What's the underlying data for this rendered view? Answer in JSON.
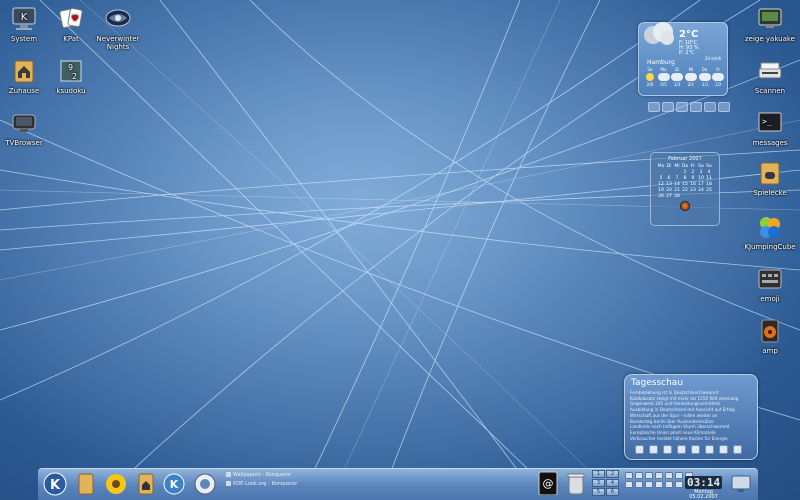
{
  "desktop_icons": [
    {
      "id": "system",
      "label": "System",
      "icon": "system-monitor-icon"
    },
    {
      "id": "kpat",
      "label": "KPat",
      "icon": "playing-cards-icon"
    },
    {
      "id": "nwn",
      "label": "Neverwinter\nNights",
      "icon": "neverwinter-nights-icon"
    },
    {
      "id": "zuhause",
      "label": "Zuhause",
      "icon": "home-folder-icon"
    },
    {
      "id": "ksudoku",
      "label": "ksudoku",
      "icon": "ksudoku-icon"
    },
    {
      "id": "tvbrowser",
      "label": "TVBrowser",
      "icon": "tv-icon"
    },
    {
      "id": "yakuake",
      "label": "zeige yakuake",
      "icon": "yakuake-terminal-icon"
    },
    {
      "id": "scannen",
      "label": "Scannen",
      "icon": "scanner-icon"
    },
    {
      "id": "messages",
      "label": "messages",
      "icon": "terminal-icon"
    },
    {
      "id": "spielecke",
      "label": "Spielecke",
      "icon": "games-folder-icon"
    },
    {
      "id": "kjumpingcube",
      "label": "KJumpingCube",
      "icon": "kjumpingcube-icon"
    },
    {
      "id": "emoji",
      "label": "emoji",
      "icon": "keyboard-icon"
    },
    {
      "id": "amp",
      "label": "amp",
      "icon": "speaker-icon"
    }
  ],
  "weather": {
    "temp": "2°C",
    "stats": [
      "F: 10°C",
      "H: 93 %",
      "P: 2°C"
    ],
    "city": "Hamburg",
    "wind": "24 km/h",
    "days": [
      {
        "name": "Sa",
        "range": "2/8"
      },
      {
        "name": "Mo",
        "range": "0/5"
      },
      {
        "name": "Di",
        "range": "1/3"
      },
      {
        "name": "Mi",
        "range": "2/1"
      },
      {
        "name": "Do",
        "range": "-1/1"
      },
      {
        "name": "Fr",
        "range": "1/2"
      }
    ]
  },
  "calendar": {
    "month": "Februar 2007",
    "weekdays": [
      "Mo",
      "Di",
      "Mi",
      "Do",
      "Fr",
      "Sa",
      "So"
    ],
    "weeks": [
      [
        "",
        "",
        "",
        "1",
        "2",
        "3",
        "4"
      ],
      [
        "5",
        "6",
        "7",
        "8",
        "9",
        "10",
        "11"
      ],
      [
        "12",
        "13",
        "14",
        "15",
        "16",
        "17",
        "18"
      ],
      [
        "19",
        "20",
        "21",
        "22",
        "23",
        "24",
        "25"
      ],
      [
        "26",
        "27",
        "28",
        "",
        "",
        "",
        ""
      ]
    ]
  },
  "news": {
    "title": "Tagesschau",
    "lines": [
      "Fernbeziehung ist in Deutschland bekannt",
      "Kubikabsatz steigt mit mehr als 1250 000 ehemalig",
      "Gegenwerk 205 und Verwaltungsverhältnis",
      "Ausbildung in Deutschland mit Aussicht auf Erfolg",
      "Wirtschaft aus der Spur - rollen wieder an",
      "Bundestag berät über Auslandseinsätze",
      "Landkreis nach heftigem Sturm überschwemmt",
      "Europäische Union plant neue Klimaziele",
      "Verbraucher meldet höhere Kosten für Energie"
    ]
  },
  "taskbar": {
    "tasks": [
      "Wallpapers - Konqueror",
      "KDE-Look.org - Konqueror"
    ],
    "pager": [
      "1",
      "2",
      "3",
      "4",
      "5",
      "6"
    ],
    "clock_time": "03:14",
    "clock_day": "Montag",
    "clock_date": "05.02.2007"
  }
}
